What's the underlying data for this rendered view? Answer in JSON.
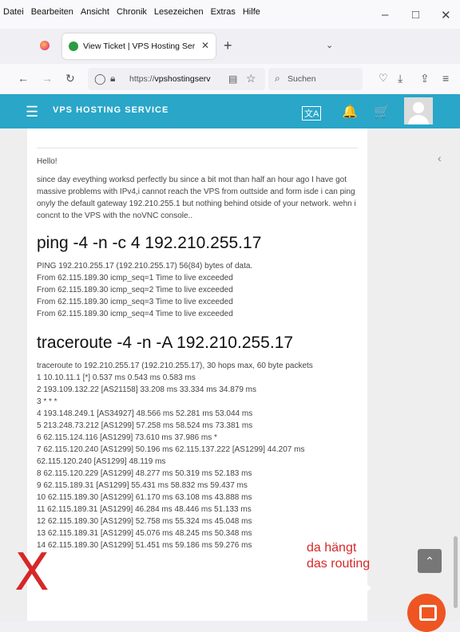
{
  "menubar": [
    "Datei",
    "Bearbeiten",
    "Ansicht",
    "Chronik",
    "Lesezeichen",
    "Extras",
    "Hilfe"
  ],
  "window_controls": {
    "minimize": "–",
    "maximize": "□",
    "close": "✕"
  },
  "tab": {
    "title": "View Ticket | VPS Hosting Servic",
    "close": "✕"
  },
  "newtab": "+",
  "tablist": "⌄",
  "nav": {
    "back": "←",
    "forward": "→",
    "reload": "↻",
    "url_prefix": "https://",
    "url_host": "vpshostingserv",
    "search_placeholder": "Suchen"
  },
  "site": {
    "brand": "VPS HOSTING SERVICE",
    "menu_icon": "☰",
    "translate_icon": "文A",
    "bell_icon": "🔔",
    "cart_icon": "🛒"
  },
  "ticket": {
    "greeting": "Hello!",
    "body": "since day eveything worksd perfectly bu since a bit mot than half an hour ago I have got massive problems with IPv4,i cannot reach the VPS from outtside and form isde i can ping onyly the default gateway 192.210.255.1 but nothing behind otside of your network. wehn i concnt to the VPS with the noVNC console..",
    "ping_cmd": "ping -4 -n -c 4 192.210.255.17",
    "ping_output": [
      "PING 192.210.255.17 (192.210.255.17) 56(84) bytes of data.",
      "From 62.115.189.30 icmp_seq=1 Time to live exceeded",
      "From 62.115.189.30 icmp_seq=2 Time to live exceeded",
      "From 62.115.189.30 icmp_seq=3 Time to live exceeded",
      "From 62.115.189.30 icmp_seq=4 Time to live exceeded"
    ],
    "traceroute_cmd": "traceroute -4 -n -A 192.210.255.17",
    "traceroute_header": "traceroute to 192.210.255.17 (192.210.255.17), 30 hops max, 60 byte packets",
    "traceroute_output": [
      "1 10.10.11.1 [*] 0.537 ms 0.543 ms 0.583 ms",
      "2 193.109.132.22 [AS21158] 33.208 ms 33.334 ms 34.879 ms",
      "3 * * *",
      "4 193.148.249.1 [AS34927] 48.566 ms 52.281 ms 53.044 ms",
      "5 213.248.73.212 [AS1299] 57.258 ms 58.524 ms 73.381 ms",
      "6 62.115.124.116 [AS1299] 73.610 ms 37.986 ms *",
      "7 62.115.120.240 [AS1299] 50.196 ms 62.115.137.222 [AS1299] 44.207 ms",
      "62.115.120.240 [AS1299] 48.119 ms",
      "8 62.115.120.229 [AS1299] 48.277 ms 50.319 ms 52.183 ms",
      "9 62.115.189.31 [AS1299] 55.431 ms 58.832 ms 59.437 ms",
      "10 62.115.189.30 [AS1299] 61.170 ms 63.108 ms 43.888 ms",
      "11 62.115.189.31 [AS1299] 46.284 ms 48.446 ms 51.133 ms",
      "12 62.115.189.30 [AS1299] 52.758 ms 55.324 ms 45.048 ms",
      "13 62.115.189.31 [AS1299] 45.076 ms 48.245 ms 50.348 ms",
      "14 62.115.189.30 [AS1299] 51.451 ms 59.186 ms 59.276 ms"
    ]
  },
  "annotation": {
    "line1": "da hängt",
    "line2": "das routing",
    "mark": "X"
  },
  "sidebar_chevron": "‹",
  "scroll_top": "⌃"
}
